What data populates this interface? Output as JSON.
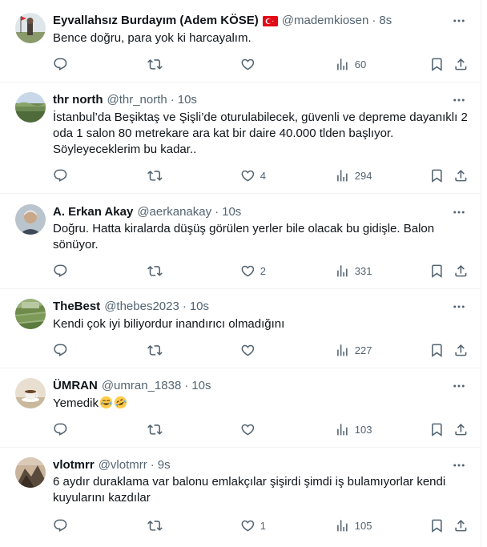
{
  "tweets": [
    {
      "name": "Eyvallahsız Burdayım (Adem KÖSE)",
      "flag": "turkey-flag",
      "handle": "@mademkiosen",
      "time": "8s",
      "text": "Bence doğru,  para yok ki harcayalım.",
      "replies": "",
      "retweets": "",
      "likes": "",
      "views": "60"
    },
    {
      "name": "thr north",
      "handle": "@thr_north",
      "time": "10s",
      "text": "İstanbul’da Beşiktaş ve Şişli’de oturulabilecek, güvenli ve depreme dayanıklı 2 oda 1 salon 80 metrekare ara kat bir daire 40.000 tlden başlıyor. Söyleyeceklerim bu kadar..",
      "replies": "",
      "retweets": "",
      "likes": "4",
      "views": "294"
    },
    {
      "name": "A. Erkan Akay",
      "handle": "@aerkanakay",
      "time": "10s",
      "text": "Doğru. Hatta kiralarda düşüş görülen yerler bile olacak bu gidişle. Balon sönüyor.",
      "replies": "",
      "retweets": "",
      "likes": "2",
      "views": "331"
    },
    {
      "name": "TheBest",
      "handle": "@thebes2023",
      "time": "10s",
      "text": "Kendi çok iyi biliyordur inandırıcı olmadığını",
      "replies": "",
      "retweets": "",
      "likes": "",
      "views": "227"
    },
    {
      "name": "ÜMRAN",
      "handle": "@umran_1838",
      "time": "10s",
      "text": "Yemedik",
      "emojis": [
        "face-with-tears-of-joy",
        "rolling-on-the-floor-laughing"
      ],
      "replies": "",
      "retweets": "",
      "likes": "",
      "views": "103"
    },
    {
      "name": "vlotmrr",
      "handle": "@vlotmrr",
      "time": "9s",
      "text": "6 aydır duraklama var balonu emlakçılar şişirdi şimdi iş bulamıyorlar kendi kuyularını kazdılar",
      "replies": "",
      "retweets": "",
      "likes": "1",
      "views": "105"
    }
  ],
  "separator": "·",
  "colors": {
    "text_primary": "#0f1419",
    "text_secondary": "#536471",
    "border": "#eff3f4",
    "flag_red": "#e30a17"
  }
}
